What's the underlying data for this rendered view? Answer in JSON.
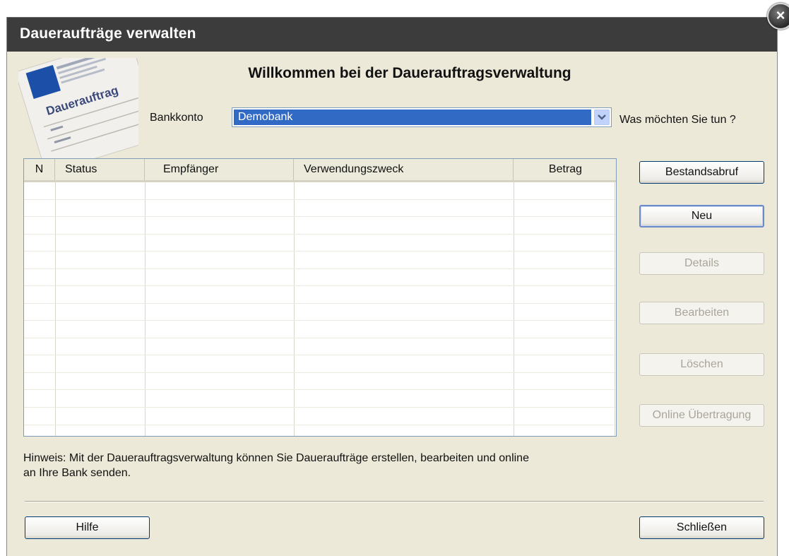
{
  "window": {
    "title": "Daueraufträge verwalten",
    "close_glyph": "×"
  },
  "header": {
    "welcome": "Willkommen bei der Dauerauftragsverwaltung",
    "illustration_text": "Dauerauftrag"
  },
  "bank": {
    "label": "Bankkonto",
    "selected": "Demobank"
  },
  "prompt": "Was möchten Sie tun ?",
  "table": {
    "columns": [
      "N",
      "Status",
      "Empfänger",
      "Verwendungszweck",
      "Betrag"
    ],
    "rows": []
  },
  "actions": {
    "bestandsabruf": "Bestandsabruf",
    "neu": "Neu",
    "details": "Details",
    "bearbeiten": "Bearbeiten",
    "loeschen": "Löschen",
    "online": "Online Übertragung"
  },
  "hint": {
    "line1": "Hinweis: Mit der Dauerauftragsverwaltung können Sie Daueraufträge erstellen, bearbeiten und online",
    "line2": "an Ihre Bank senden."
  },
  "footer": {
    "help": "Hilfe",
    "close": "Schließen"
  },
  "colors": {
    "titlebar": "#3c3c3c",
    "dialog_bg": "#ece9d8",
    "selection": "#316ac5"
  },
  "icons": {
    "close": "close-icon",
    "dropdown": "chevron-down-icon"
  }
}
